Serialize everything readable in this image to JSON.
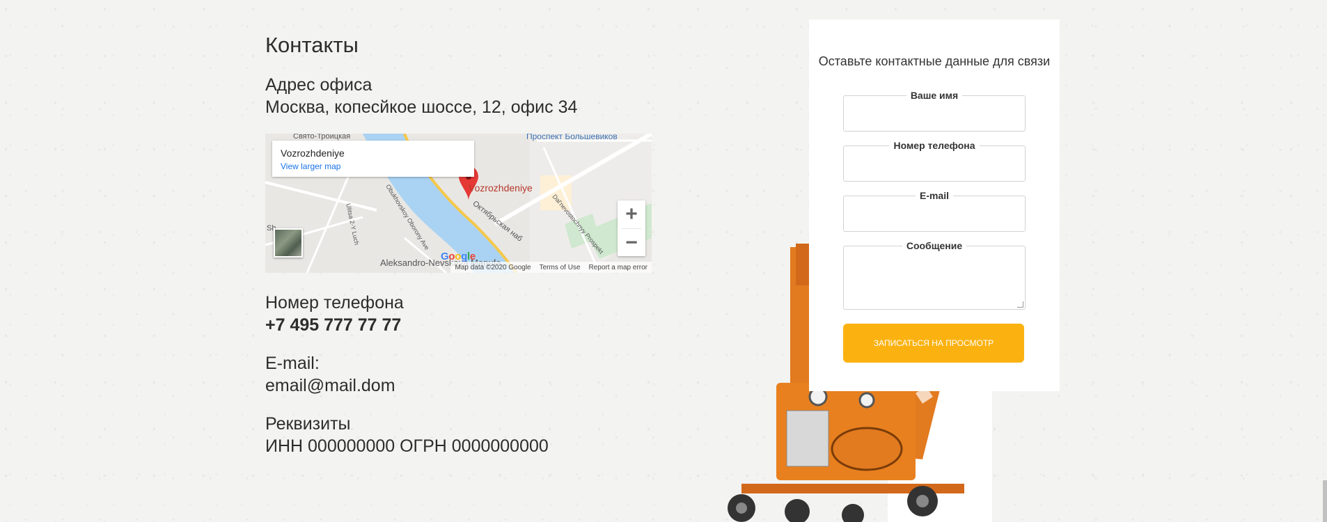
{
  "contacts": {
    "title": "Контакты",
    "office_label": "Адрес офиса",
    "office_value": "Москва, копесйкое шоссе, 12, офис 34",
    "phone_label": "Номер телефона",
    "phone_value": "+7 495 777 77 77",
    "email_label": "E-mail:",
    "email_value": "email@mail.dom",
    "requisites_label": "Реквизиты",
    "requisites_value": "ИНН 000000000 ОГРН 0000000000"
  },
  "map": {
    "place_name": "Vozrozhdeniye",
    "view_larger": "View larger map",
    "pin_label": "Vozrozhdeniye",
    "zoom_in": "+",
    "zoom_out": "−",
    "attribution": [
      "Map data ©2020 Google",
      "Terms of Use",
      "Report a map error"
    ],
    "google_logo": "Google",
    "streets": [
      "Свято-Троицкая",
      "Проспект Большевиков",
      "Октябрьская наб",
      "Obukhovskoy Oborony Ave",
      "Ulitsa 2-Y Luch",
      "Dal'nevostochnyy Prospekt",
      "Aleksandro-Nevskaya Manufa...",
      "Sh"
    ]
  },
  "form": {
    "title": "Оставьте контактные данные для связи",
    "name_label": "Ваше имя",
    "phone_label": "Номер телефона",
    "email_label": "E-mail",
    "message_label": "Сообщение",
    "submit_label": "ЗАПИСАТЬСЯ НА ПРОСМОТР",
    "button_color": "#fbb211"
  },
  "colors": {
    "accent": "#fbb211",
    "machine_orange": "#e27a1f"
  }
}
